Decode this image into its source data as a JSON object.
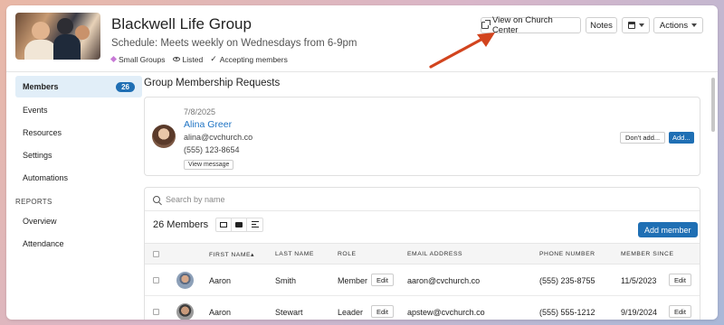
{
  "header": {
    "title": "Blackwell Life Group",
    "schedule": "Schedule: Meets weekly on Wednesdays from 6-9pm",
    "tags": [
      "Small Groups",
      "Listed",
      "Accepting members"
    ],
    "buttons": {
      "view_church_center": "View on Church Center",
      "notes": "Notes",
      "actions": "Actions"
    },
    "icons": [
      "external-link-icon",
      "calendar-icon",
      "chevron-down-icon"
    ]
  },
  "sidebar": {
    "items": [
      {
        "label": "Members",
        "badge": "26",
        "active": true
      },
      {
        "label": "Events"
      },
      {
        "label": "Resources"
      },
      {
        "label": "Settings"
      },
      {
        "label": "Automations"
      }
    ],
    "reports_heading": "REPORTS",
    "reports": [
      {
        "label": "Overview"
      },
      {
        "label": "Attendance"
      }
    ]
  },
  "requests": {
    "heading": "Group Membership Requests",
    "item": {
      "date": "7/8/2025",
      "name": "Alina Greer",
      "email": "alina@cvchurch.co",
      "phone": "(555) 123-8654",
      "view_message": "View message",
      "dont_add": "Don't add...",
      "add": "Add..."
    }
  },
  "members": {
    "search_placeholder": "Search by name",
    "count_label": "26 Members",
    "add_member": "Add member",
    "columns": [
      "FIRST NAME",
      "LAST NAME",
      "ROLE",
      "EMAIL ADDRESS",
      "PHONE NUMBER",
      "MEMBER SINCE"
    ],
    "sort_indicator": "▴",
    "edit_label": "Edit",
    "rows": [
      {
        "first": "Aaron",
        "last": "Smith",
        "role": "Member",
        "email": "aaron@cvchurch.co",
        "phone": "(555) 235-8755",
        "since": "11/5/2023"
      },
      {
        "first": "Aaron",
        "last": "Stewart",
        "role": "Leader",
        "email": "apstew@cvchurch.co",
        "phone": "(555) 555-1212",
        "since": "9/19/2024"
      }
    ]
  },
  "colors": {
    "accent": "#1f6fb4",
    "link": "#1f74c4",
    "active_nav_bg": "#e1eef8",
    "annotation_arrow": "#d2441e"
  }
}
